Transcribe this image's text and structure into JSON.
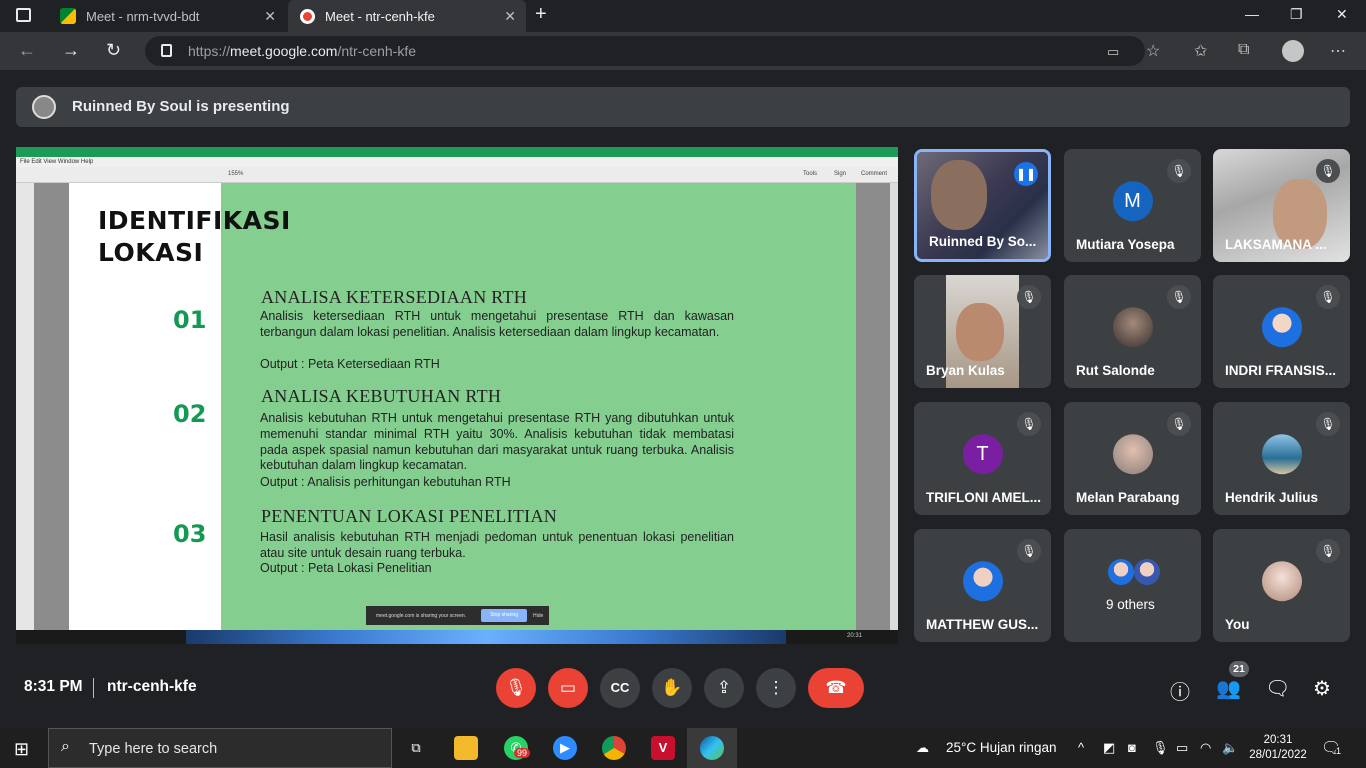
{
  "browser": {
    "tabs": [
      {
        "title": "Meet - nrm-tvvd-bdt"
      },
      {
        "title": "Meet - ntr-cenh-kfe"
      }
    ],
    "url_prefix": "https://",
    "url_domain": "meet.google.com",
    "url_path": "/ntr-cenh-kfe"
  },
  "banner": {
    "text": "Ruinned By Soul is presenting"
  },
  "shared_doc": {
    "title_line1": "IDENTIFIKASI",
    "title_line2": "LOKASI",
    "viewer_menu": "File   Edit   View   Window   Help",
    "viewer_tools": [
      "Tools",
      "Sign",
      "Comment"
    ],
    "viewer_zoom": "155%",
    "sections": [
      {
        "num": "01",
        "heading": "ANALISA KETERSEDIAAN RTH",
        "body": "Analisis ketersediaan RTH untuk mengetahui presentase RTH dan kawasan terbangun dalam lokasi penelitian. Analisis ketersediaan dalam lingkup kecamatan.",
        "output": "Output : Peta Ketersediaan RTH"
      },
      {
        "num": "02",
        "heading": "ANALISA KEBUTUHAN RTH",
        "body": "Analisis kebutuhan RTH untuk mengetahui presentase RTH yang dibutuhkan untuk memenuhi standar minimal RTH yaitu 30%. Analisis kebutuhan tidak membatasi pada aspek spasial namun kebutuhan dari masyarakat untuk ruang terbuka. Analisis kebutuhan dalam lingkup kecamatan.",
        "output": "Output : Analisis perhitungan kebutuhan RTH"
      },
      {
        "num": "03",
        "heading": "PENENTUAN LOKASI PENELITIAN",
        "body": "Hasil analisis kebutuhan RTH menjadi pedoman untuk penentuan lokasi penelitian atau site untuk desain ruang terbuka.",
        "output": "Output : Peta Lokasi Penelitian"
      }
    ],
    "share_notice": "meet.google.com is sharing your screen.",
    "stop_sharing": "Stop sharing",
    "hide": "Hide",
    "inner_clock": "20:31"
  },
  "participants": [
    {
      "name": "Ruinned By So...",
      "type": "video",
      "speaking": true
    },
    {
      "name": "Mutiara Yosepa",
      "type": "letter",
      "initial": "M",
      "color": "#1565c0"
    },
    {
      "name": "LAKSAMANA ...",
      "type": "video"
    },
    {
      "name": "Bryan Kulas",
      "type": "video"
    },
    {
      "name": "Rut Salonde",
      "type": "photo"
    },
    {
      "name": "INDRI FRANSIS...",
      "type": "photo"
    },
    {
      "name": "TRIFLONI AMEL...",
      "type": "letter",
      "initial": "T",
      "color": "#7b1fa2"
    },
    {
      "name": "Melan Parabang",
      "type": "photo"
    },
    {
      "name": "Hendrik Julius",
      "type": "photo"
    },
    {
      "name": "MATTHEW GUS...",
      "type": "photo"
    },
    {
      "name": "9 others",
      "type": "group"
    },
    {
      "name": "You",
      "type": "photo"
    }
  ],
  "meeting": {
    "time": "8:31 PM",
    "code": "ntr-cenh-kfe",
    "people_count": "21"
  },
  "taskbar": {
    "search_placeholder": "Type here to search",
    "whatsapp_badge": "99",
    "weather": "25°C  Hujan ringan",
    "clock_time": "20:31",
    "clock_date": "28/01/2022",
    "notif_count": "1"
  }
}
